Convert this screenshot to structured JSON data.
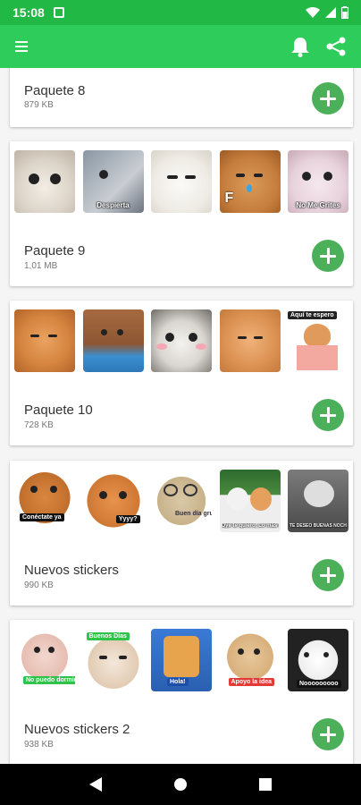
{
  "status_bar": {
    "time": "15:08"
  },
  "app_bar": {
    "menu_icon": "hamburger-menu-icon",
    "actions": [
      "bell-icon",
      "share-icon"
    ]
  },
  "packs": [
    {
      "title": "Paquete 8",
      "size": "879 KB"
    },
    {
      "title": "Paquete 9",
      "size": "1,01 MB",
      "captions": [
        "",
        "Despierta",
        "",
        "",
        "No Me Grites"
      ]
    },
    {
      "title": "Paquete 10",
      "size": "728 KB",
      "captions": [
        "",
        "",
        "",
        "",
        "Aquí te espero"
      ]
    },
    {
      "title": "Nuevos stickers",
      "size": "990 KB",
      "captions": [
        "Conéctate ya",
        "Yyyy?",
        "Buen día grupo",
        "Oye te quiero, Lo más a lugar",
        "TE DESEO BUENAS NOCHES"
      ]
    },
    {
      "title": "Nuevos stickers 2",
      "size": "938 KB",
      "captions": [
        "No puedo dormir",
        "Buenos Días",
        "Hola!",
        "Apoyo la idea",
        "Nooooooooo"
      ]
    }
  ],
  "colors": {
    "status_bar": "#22b846",
    "app_bar": "#2ecc5a",
    "add_button": "#4caf5a"
  }
}
